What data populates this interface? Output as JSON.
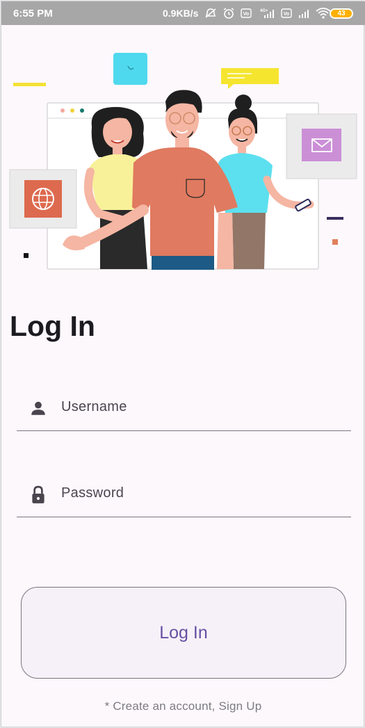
{
  "status_bar": {
    "time": "6:55 PM",
    "speed": "0.9KB/s",
    "battery": "43",
    "network_1": "4G+",
    "network_2": "Vo"
  },
  "page": {
    "title": "Log In"
  },
  "form": {
    "username_label": "Username",
    "password_label": "Password",
    "username_icon": "person-icon",
    "password_icon": "lock-icon"
  },
  "actions": {
    "login_label": "Log In",
    "signup_text": "* Create an account, Sign Up"
  },
  "colors": {
    "accent": "#6750a4",
    "background": "#fdf8fc",
    "status_bar": "#a7a7a7"
  }
}
